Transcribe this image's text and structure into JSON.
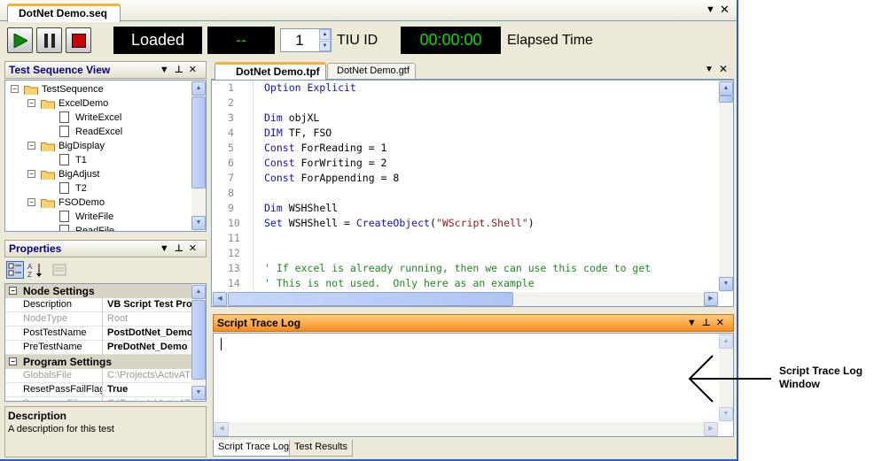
{
  "doc_tab": {
    "title": "DotNet Demo.seq"
  },
  "toolbar": {
    "status": "Loaded",
    "status_color": "#ffffff",
    "result_display": "--",
    "result_color": "#00c800",
    "tiu_id_value": "1",
    "tiu_id_label": "TIU ID",
    "elapsed_time": "00:00:00",
    "elapsed_time_color": "#00e000",
    "elapsed_label": "Elapsed Time"
  },
  "test_sequence_view": {
    "title": "Test Sequence View",
    "items": [
      {
        "label": "TestSequence",
        "type": "folder",
        "expanded": true
      },
      {
        "label": "ExcelDemo",
        "type": "folder",
        "expanded": true
      },
      {
        "label": "WriteExcel",
        "type": "file"
      },
      {
        "label": "ReadExcel",
        "type": "file"
      },
      {
        "label": "BigDisplay",
        "type": "folder",
        "expanded": true
      },
      {
        "label": "T1",
        "type": "file"
      },
      {
        "label": "BigAdjust",
        "type": "folder",
        "expanded": true
      },
      {
        "label": "T2",
        "type": "file"
      },
      {
        "label": "FSODemo",
        "type": "folder",
        "expanded": true
      },
      {
        "label": "WriteFile",
        "type": "file"
      },
      {
        "label": "ReadFile",
        "type": "file"
      }
    ]
  },
  "properties": {
    "title": "Properties",
    "categories": [
      {
        "name": "Node Settings",
        "rows": [
          {
            "name": "Description",
            "value": "VB Script Test Pro",
            "disabled": false
          },
          {
            "name": "NodeType",
            "value": "Root",
            "disabled": true
          },
          {
            "name": "PostTestName",
            "value": "PostDotNet_Demo",
            "disabled": false
          },
          {
            "name": "PreTestName",
            "value": "PreDotNet_Demo",
            "disabled": false
          }
        ]
      },
      {
        "name": "Program Settings",
        "rows": [
          {
            "name": "GlobalsFile",
            "value": "C:\\Projects\\ActivATE",
            "disabled": true
          },
          {
            "name": "ResetPassFailFlag",
            "value": "True",
            "disabled": false
          },
          {
            "name": "SequenceFile",
            "value": "C:\\Projects\\ActivATE",
            "disabled": true
          }
        ]
      }
    ],
    "help_title": "Description",
    "help_text": "A description for this test"
  },
  "editor": {
    "tabs": [
      {
        "label": "DotNet Demo.tpf",
        "active": true
      },
      {
        "label": "DotNet Demo.gtf",
        "active": false
      }
    ],
    "lines": [
      {
        "n": "1",
        "parts": [
          {
            "t": "Option Explicit",
            "k": "k"
          }
        ]
      },
      {
        "n": "2",
        "parts": []
      },
      {
        "n": "3",
        "parts": [
          {
            "t": "Dim",
            "k": "k"
          },
          {
            "t": " objXL",
            "k": ""
          }
        ]
      },
      {
        "n": "4",
        "parts": [
          {
            "t": "DIM",
            "k": "k"
          },
          {
            "t": " TF, FSO",
            "k": ""
          }
        ]
      },
      {
        "n": "5",
        "parts": [
          {
            "t": "Const",
            "k": "k"
          },
          {
            "t": " ForReading = 1",
            "k": ""
          }
        ]
      },
      {
        "n": "6",
        "parts": [
          {
            "t": "Const",
            "k": "k"
          },
          {
            "t": " ForWriting = 2",
            "k": ""
          }
        ]
      },
      {
        "n": "7",
        "parts": [
          {
            "t": "Const",
            "k": "k"
          },
          {
            "t": " ForAppending = 8",
            "k": ""
          }
        ]
      },
      {
        "n": "8",
        "parts": []
      },
      {
        "n": "9",
        "parts": [
          {
            "t": "Dim",
            "k": "k"
          },
          {
            "t": " WSHShell",
            "k": ""
          }
        ]
      },
      {
        "n": "10",
        "parts": [
          {
            "t": "Set",
            "k": "k"
          },
          {
            "t": " WSHShell = ",
            "k": ""
          },
          {
            "t": "CreateObject",
            "k": "k"
          },
          {
            "t": "(",
            "k": ""
          },
          {
            "t": "\"WScript.Shell\"",
            "k": "s"
          },
          {
            "t": ")",
            "k": ""
          }
        ]
      },
      {
        "n": "11",
        "parts": []
      },
      {
        "n": "12",
        "parts": []
      },
      {
        "n": "13",
        "parts": [
          {
            "t": "' If excel is already running, then we can use this code to get",
            "k": "c"
          }
        ]
      },
      {
        "n": "14",
        "parts": [
          {
            "t": "' This is not used.  Only here as an example",
            "k": "c"
          }
        ]
      }
    ]
  },
  "trace_log": {
    "title": "Script Trace Log",
    "content": "",
    "bottom_tabs": [
      {
        "label": "Script Trace Log",
        "active": true
      },
      {
        "label": "Test Results",
        "active": false
      }
    ]
  },
  "annotation": {
    "text_line1": "Script Trace Log",
    "text_line2": "Window"
  }
}
